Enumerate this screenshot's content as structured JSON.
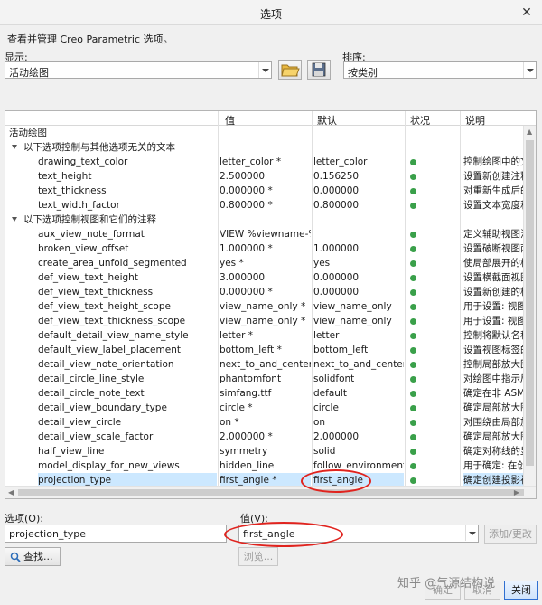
{
  "window": {
    "title": "选项",
    "close_glyph": "✕"
  },
  "description": "查看并管理 Creo Parametric 选项。",
  "show": {
    "label": "显示:",
    "value": "活动绘图"
  },
  "sort": {
    "label": "排序:",
    "value": "按类别"
  },
  "table": {
    "headers": {
      "name": "",
      "value": "值",
      "default": "默认",
      "status": "状况",
      "desc": "说明"
    },
    "rows": [
      {
        "kind": "root",
        "name": "活动绘图"
      },
      {
        "kind": "group",
        "name": "以下选项控制与其他选项无关的文本"
      },
      {
        "kind": "opt",
        "name": "drawing_text_color",
        "value": "letter_color *",
        "def": "letter_color",
        "desc": "控制绘图中的文"
      },
      {
        "kind": "opt",
        "name": "text_height",
        "value": "2.500000",
        "def": "0.156250",
        "desc": "设置新创建注释"
      },
      {
        "kind": "opt",
        "name": "text_thickness",
        "value": "0.000000 *",
        "def": "0.000000",
        "desc": "对重新生成后的"
      },
      {
        "kind": "opt",
        "name": "text_width_factor",
        "value": "0.800000 *",
        "def": "0.800000",
        "desc": "设置文本宽度和"
      },
      {
        "kind": "group",
        "name": "以下选项控制视图和它们的注释"
      },
      {
        "kind": "opt",
        "name": "aux_view_note_format",
        "value": "VIEW %viewname-%v",
        "def": "",
        "desc": "定义辅助视图注"
      },
      {
        "kind": "opt",
        "name": "broken_view_offset",
        "value": "1.000000 *",
        "def": "1.000000",
        "desc": "设置破断视图两"
      },
      {
        "kind": "opt",
        "name": "create_area_unfold_segmented",
        "value": "yes *",
        "def": "yes",
        "desc": "使局部展开的横"
      },
      {
        "kind": "opt",
        "name": "def_view_text_height",
        "value": "3.000000",
        "def": "0.000000",
        "desc": "设置横截面视图"
      },
      {
        "kind": "opt",
        "name": "def_view_text_thickness",
        "value": "0.000000 *",
        "def": "0.000000",
        "desc": "设置新创建的横"
      },
      {
        "kind": "opt",
        "name": "def_view_text_height_scope",
        "value": "view_name_only *",
        "def": "view_name_only",
        "desc": "用于设置: 视图文"
      },
      {
        "kind": "opt",
        "name": "def_view_text_thickness_scope",
        "value": "view_name_only *",
        "def": "view_name_only",
        "desc": "用于设置: 视图文"
      },
      {
        "kind": "opt",
        "name": "default_detail_view_name_style",
        "value": "letter *",
        "def": "letter",
        "desc": "控制将默认名称"
      },
      {
        "kind": "opt",
        "name": "default_view_label_placement",
        "value": "bottom_left *",
        "def": "bottom_left",
        "desc": "设置视图标签的"
      },
      {
        "kind": "opt",
        "name": "detail_view_note_orientation",
        "value": "next_to_and_centered",
        "def": "next_to_and_centered",
        "desc": "控制局部放大图"
      },
      {
        "kind": "opt",
        "name": "detail_circle_line_style",
        "value": "phantomfont",
        "def": "solidfont",
        "desc": "对绘图中指示局"
      },
      {
        "kind": "opt",
        "name": "detail_circle_note_text",
        "value": "simfang.ttf",
        "def": "default",
        "desc": "确定在非 ASME"
      },
      {
        "kind": "opt",
        "name": "detail_view_boundary_type",
        "value": "circle *",
        "def": "circle",
        "desc": "确定局部放大图"
      },
      {
        "kind": "opt",
        "name": "detail_view_circle",
        "value": "on *",
        "def": "on",
        "desc": "对围绕由局部放"
      },
      {
        "kind": "opt",
        "name": "detail_view_scale_factor",
        "value": "2.000000 *",
        "def": "2.000000",
        "desc": "确定局部放大图"
      },
      {
        "kind": "opt",
        "name": "half_view_line",
        "value": "symmetry",
        "def": "solid",
        "desc": "确定对称线的显"
      },
      {
        "kind": "opt",
        "name": "model_display_for_new_views",
        "value": "hidden_line",
        "def": "follow_environment",
        "desc": "用于确定: 在创建"
      },
      {
        "kind": "opt",
        "name": "projection_type",
        "value": "first_angle *",
        "def": "first_angle",
        "desc": "确定创建投影视",
        "selected": true
      }
    ]
  },
  "option": {
    "label": "选项(O):",
    "value": "projection_type"
  },
  "value_field": {
    "label": "值(V):",
    "value": "first_angle"
  },
  "buttons": {
    "add_change": "添加/更改",
    "find": "查找...",
    "browse": "浏览...",
    "ok": "确定",
    "cancel": "取消",
    "close": "关闭"
  },
  "watermark": "知乎 @气源结构说",
  "colors": {
    "status_ok": "#3aa04a",
    "selection": "#cce8ff",
    "annotation": "#e0231e"
  }
}
